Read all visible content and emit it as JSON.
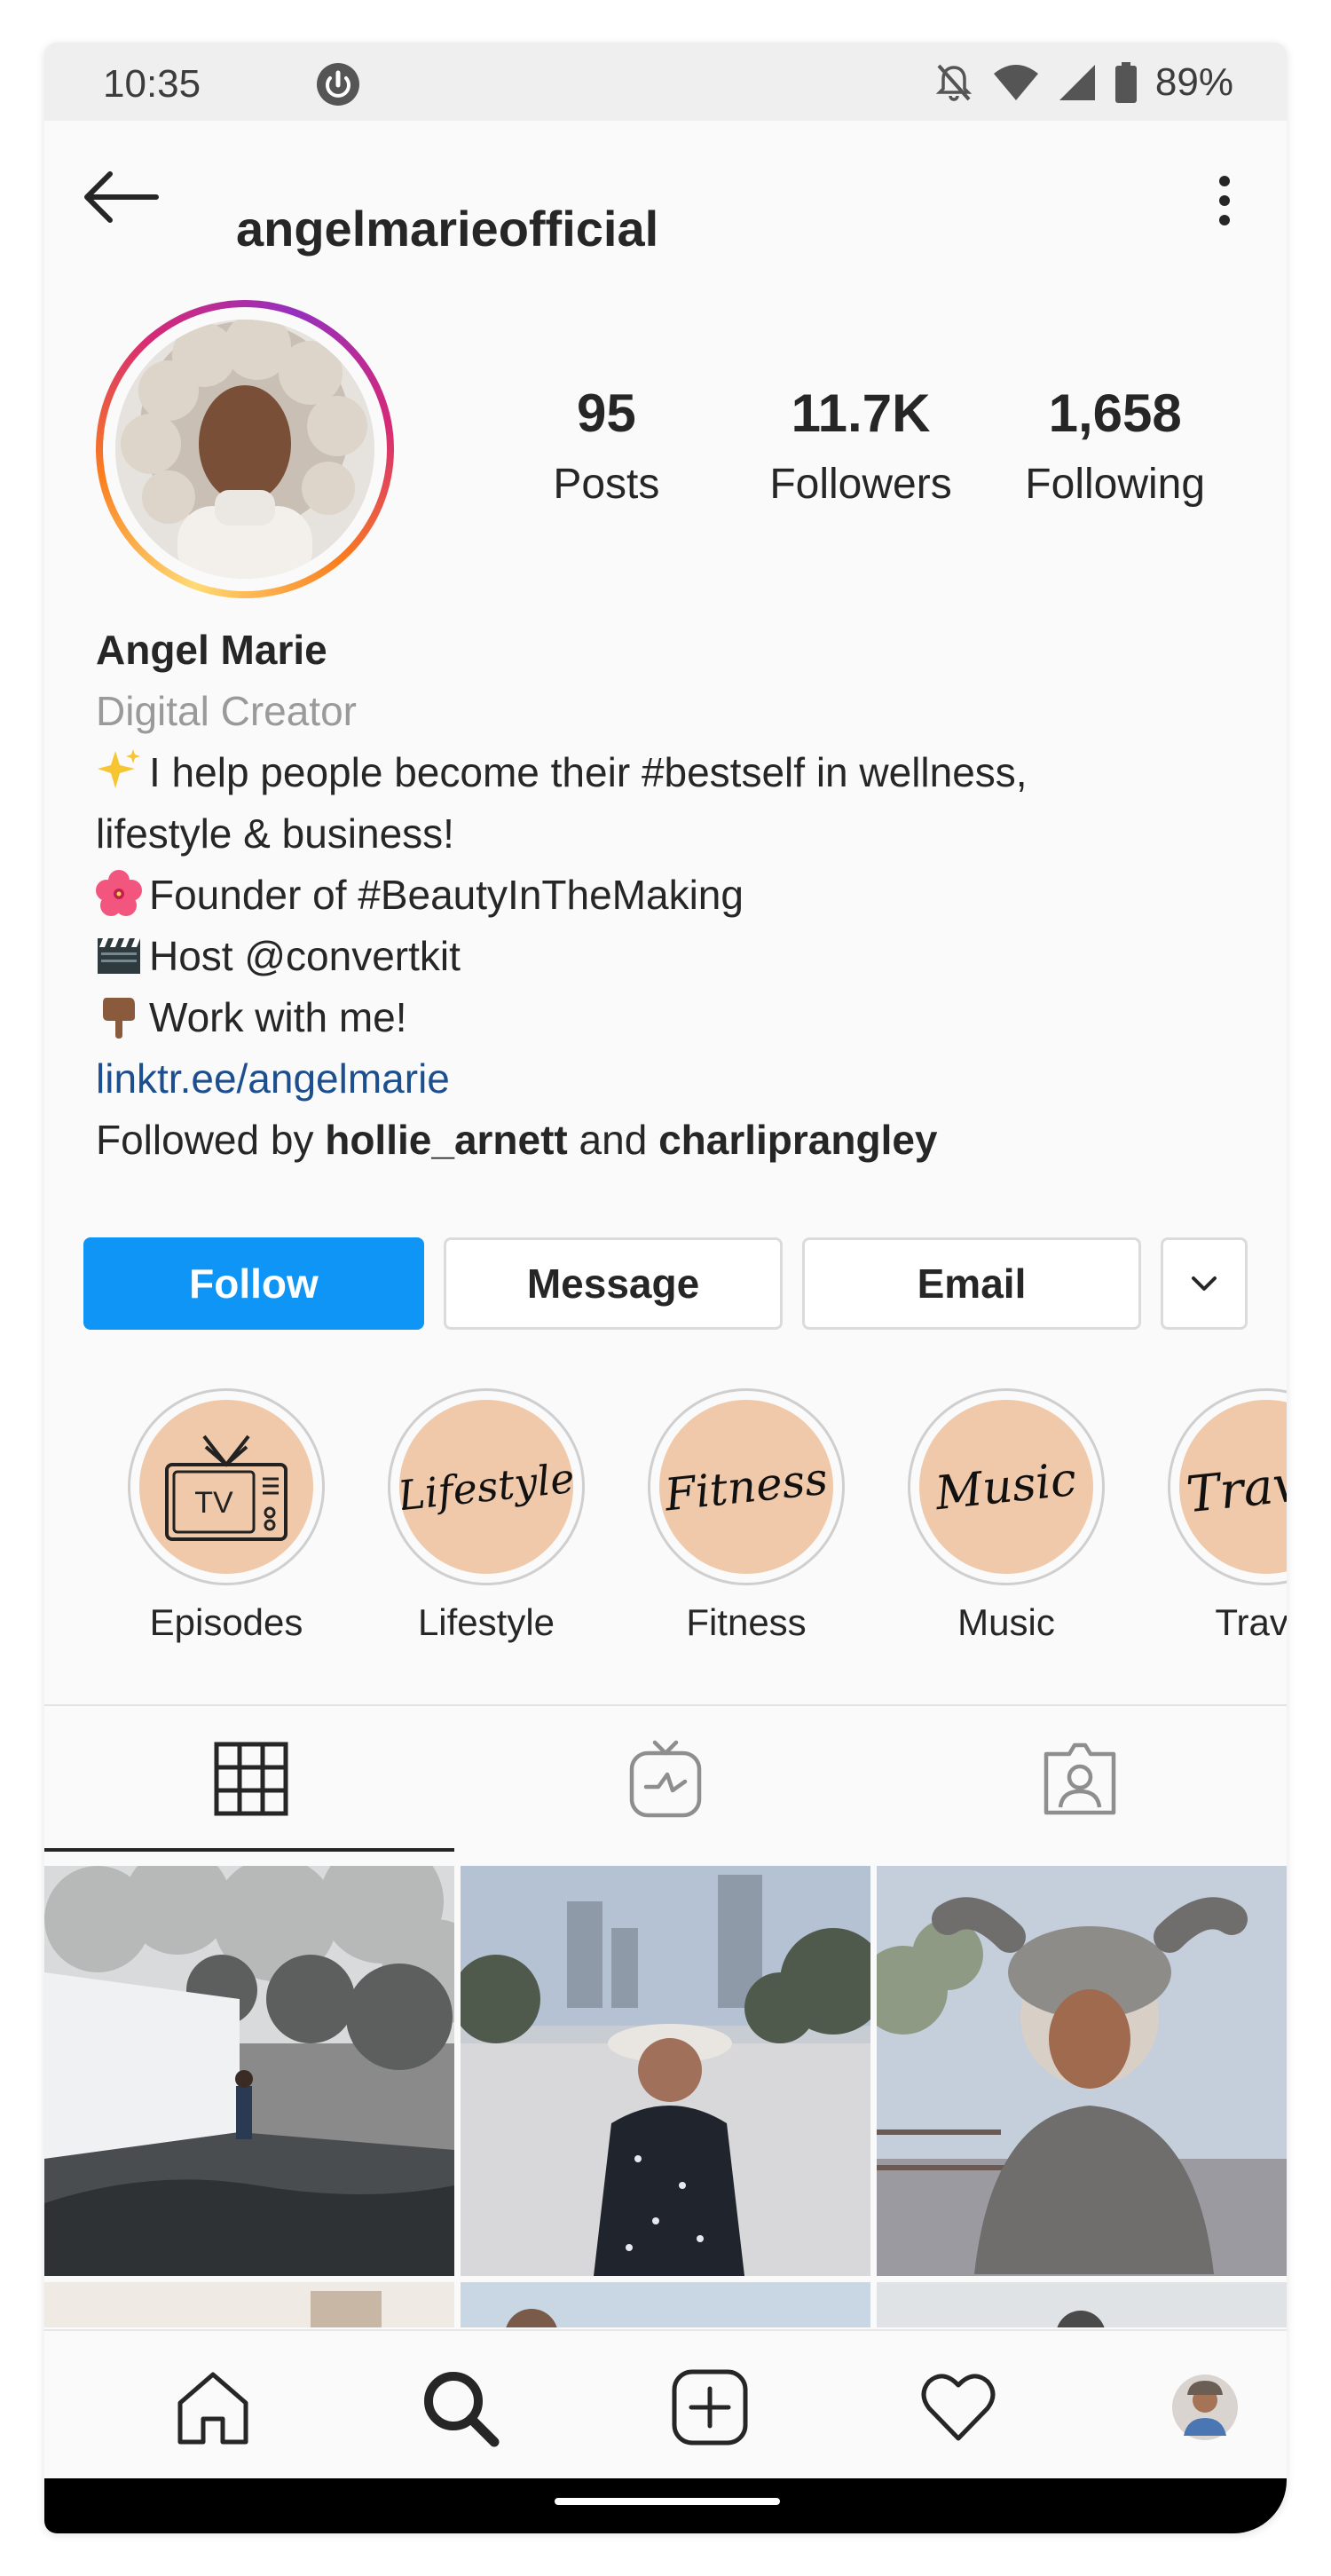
{
  "status_bar": {
    "time": "10:35",
    "battery": "89%",
    "icons": [
      "data-saver-icon",
      "bell-off-icon",
      "wifi-icon",
      "signal-icon",
      "battery-icon"
    ]
  },
  "header": {
    "username": "angelmarieofficial",
    "icons": [
      "back-arrow-icon",
      "more-vertical-icon"
    ]
  },
  "profile": {
    "stats": [
      {
        "value": "95",
        "label": "Posts"
      },
      {
        "value": "11.7K",
        "label": "Followers"
      },
      {
        "value": "1,658",
        "label": "Following"
      }
    ],
    "name": "Angel Marie",
    "category": "Digital Creator",
    "bio_lines": [
      {
        "emoji": "sparkles-emoji",
        "text": "I help people become their #bestself in wellness,"
      },
      {
        "emoji": "",
        "text": "lifestyle & business!"
      },
      {
        "emoji": "hibiscus-emoji",
        "text": "Founder of #BeautyInTheMaking"
      },
      {
        "emoji": "clapper-board-emoji",
        "text": "Host @convertkit"
      },
      {
        "emoji": "pointing-down-emoji",
        "text": "Work with me!"
      }
    ],
    "link": "linktr.ee/angelmarie",
    "followed_by": {
      "prefix": "Followed by",
      "user1": "hollie_arnett",
      "joiner": "and",
      "user2": "charliprangley"
    }
  },
  "actions": {
    "follow": "Follow",
    "message": "Message",
    "email": "Email"
  },
  "highlights": [
    {
      "label": "Episodes",
      "cover": "TV"
    },
    {
      "label": "Lifestyle",
      "cover": "Lifestyle"
    },
    {
      "label": "Fitness",
      "cover": "Fitness"
    },
    {
      "label": "Music",
      "cover": "Music"
    },
    {
      "label": "Travel",
      "cover": "Travel"
    }
  ],
  "tabs": [
    "grid-icon",
    "igtv-icon",
    "tagged-icon"
  ],
  "bottom_nav": [
    "home-icon",
    "search-icon",
    "new-post-icon",
    "activity-heart-icon",
    "profile-avatar"
  ],
  "colors": {
    "follow_button": "#0e95f6",
    "link": "#1d4f8f",
    "highlight_disc": "#efc9a9",
    "category": "#9a9a9a"
  }
}
